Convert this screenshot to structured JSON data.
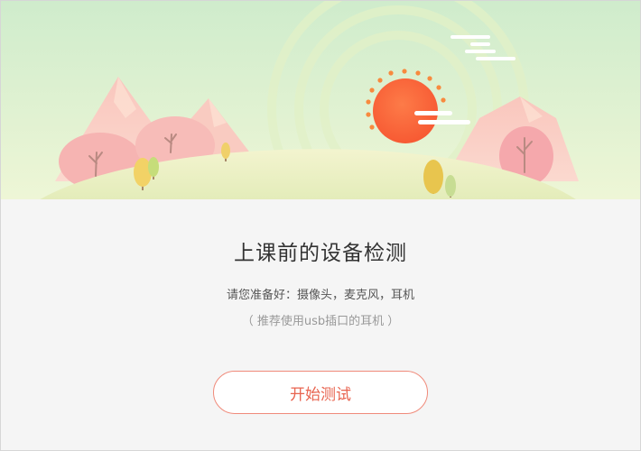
{
  "main": {
    "title": "上课前的设备检测",
    "subtitle": "请您准备好：摄像头，麦克风，耳机",
    "hint": "（ 推荐使用usb插口的耳机 ）",
    "start_button_label": "开始测试"
  },
  "colors": {
    "accent": "#e8634f",
    "button_border": "#f08a7a",
    "banner_sky": "#d3efcf",
    "sun": "#fb6a3d"
  }
}
